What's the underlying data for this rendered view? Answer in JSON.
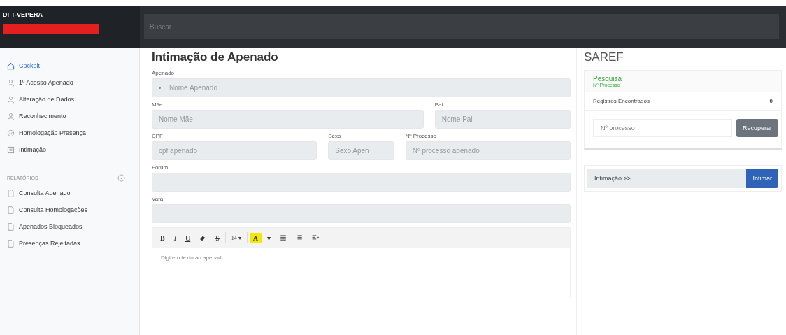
{
  "header": {
    "brand": "DFT-VEPERA",
    "search": {
      "placeholder": "Buscar"
    }
  },
  "sidebar": {
    "items": [
      {
        "label": "Cockpit",
        "selected": true
      },
      {
        "label": "1º Acesso Apenado",
        "selected": false
      },
      {
        "label": "Alteração de Dados",
        "selected": false
      },
      {
        "label": "Reconhecimento",
        "selected": false
      },
      {
        "label": "Homologação Presença",
        "selected": false
      },
      {
        "label": "Intimação",
        "selected": false
      }
    ],
    "section": {
      "title": "RELATÓRIOS",
      "items": [
        {
          "label": "Consulta Apenado"
        },
        {
          "label": "Consulta Homologações"
        },
        {
          "label": "Apenados Bloqueados"
        },
        {
          "label": "Presenças Rejeitadas"
        }
      ]
    }
  },
  "form": {
    "title": "Intimação de Apenado",
    "fields": [
      {
        "label": "Apenado",
        "placeholder": "Nome Apenado",
        "kind": "select"
      },
      {
        "label": "Mãe",
        "placeholder": "Nome Mãe",
        "kind": "text"
      },
      {
        "label": "Pai",
        "placeholder": "Nome Pai",
        "kind": "text"
      },
      {
        "label": "CPF",
        "placeholder": "cpf apenado",
        "kind": "text"
      },
      {
        "label": "Sexo",
        "placeholder": "Sexo Apen",
        "kind": "text"
      },
      {
        "label": "Nº Processo",
        "placeholder": "Nº processo apenado",
        "kind": "text"
      },
      {
        "label": "Forum",
        "kind": "text"
      },
      {
        "label": "Vara",
        "kind": "text"
      }
    ],
    "editor": {
      "toolbar": [
        {
          "kind": "bold",
          "label": "B"
        },
        {
          "kind": "italic",
          "label": "I"
        },
        {
          "kind": "underline",
          "label": "U"
        },
        {
          "kind": "eraser"
        },
        {
          "kind": "strike",
          "label": "S"
        },
        {
          "kind": "sep"
        },
        {
          "kind": "dropdown",
          "label": "14 ▾"
        },
        {
          "kind": "sep"
        },
        {
          "kind": "color",
          "label": "A"
        },
        {
          "kind": "caret",
          "label": "▾"
        },
        {
          "kind": "ul"
        },
        {
          "kind": "ol"
        },
        {
          "kind": "align"
        }
      ],
      "placeholder": "Digite o texto ao apenado"
    }
  },
  "saref": {
    "title": "SAREF",
    "card_title": "Pesquisa",
    "card_subtitle": "Nº Processo",
    "records_label": "Registros Encontrados",
    "records_count": "0",
    "process_placeholder": "Nº processo",
    "recover_button": "Recuperar",
    "intimation_field": "Intimação >>",
    "intimate_button": "Intimar"
  }
}
